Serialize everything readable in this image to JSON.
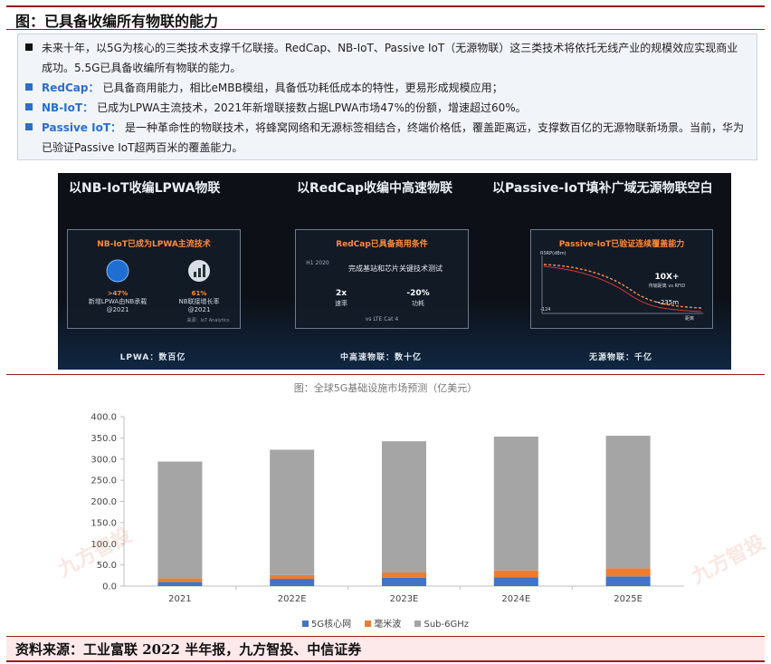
{
  "header": {
    "title": "图：已具备收编所有物联的能力"
  },
  "bullets": [
    {
      "keyword": "",
      "line1": "未来十年，以5G为核心的三类技术支撑千亿联接。RedCap、NB-IoT、Passive IoT（无源物联）这三类技术将依托无线产业的规模效应实现商业",
      "line2": "成功。5.5G已具备收编所有物联的能力。"
    },
    {
      "keyword": "RedCap：",
      "line1": "已具备商用能力，相比eMBB模组，具备低功耗低成本的特性，更易形成规模应用；",
      "line2": ""
    },
    {
      "keyword": "NB-IoT：",
      "line1": "已成为LPWA主流技术，2021年新增联接数占据LPWA市场47%的份额，增速超过60%。",
      "line2": ""
    },
    {
      "keyword": "Passive IoT：",
      "line1": "是一种革命性的物联技术，将蜂窝网络和无源标签相结合，终端价格低，覆盖距离远，支撑数百亿的无源物联新场景。当前，华为",
      "line2": "已验证Passive IoT超两百米的覆盖能力。"
    }
  ],
  "image_panel": {
    "headings": [
      "以NB-IoT收编LPWA物联",
      "以RedCap收编中高速物联",
      "以Passive-IoT填补广域无源物联空白"
    ],
    "cards": [
      {
        "title": "NB-IoT已成为LPWA主流技术",
        "stats": [
          {
            "value": ">47%",
            "label1": "新增LPWA由NB承载",
            "label2": "@2021"
          },
          {
            "value": "61%",
            "label1": "NB联接增长率",
            "label2": "@2021"
          }
        ],
        "source": "来源：IoT Analytics",
        "footer": "LPWA：数百亿"
      },
      {
        "title": "RedCap已具备商用条件",
        "subtitle": "完成基站和芯片关键技术测试",
        "year_label": "H1 2020",
        "stats": [
          {
            "value": "2x",
            "label1": "速率"
          },
          {
            "value": "-20%",
            "label1": "功耗"
          }
        ],
        "note": "vs LTE Cat 4",
        "footer": "中高速物联：数十亿"
      },
      {
        "title": "Passive-IoT已验证连续覆盖能力",
        "y_label": "RSRP(dBm)",
        "x_label": "距离",
        "value_label": "-124",
        "gain": "10X+",
        "gain_note": "传输距离 vs RFID",
        "distance": "~235m",
        "footer": "无源物联：千亿"
      }
    ]
  },
  "chart_data": {
    "type": "bar",
    "stacked": true,
    "title": "图：全球5G基础设施市场预测（亿美元）",
    "categories": [
      "2021",
      "2022E",
      "2023E",
      "2024E",
      "2025E"
    ],
    "series": [
      {
        "name": "5G核心网",
        "color": "#4472c4",
        "values": [
          10,
          17,
          20,
          21,
          23
        ]
      },
      {
        "name": "毫米波",
        "color": "#ed7d31",
        "values": [
          8,
          9,
          12,
          16,
          19
        ]
      },
      {
        "name": "Sub-6GHz",
        "color": "#a5a5a5",
        "values": [
          276,
          296,
          310,
          316,
          313
        ]
      }
    ],
    "ylim": [
      0,
      400
    ],
    "yticks": [
      "0.0",
      "50.0",
      "100.0",
      "150.0",
      "200.0",
      "250.0",
      "300.0",
      "350.0",
      "400.0"
    ],
    "ytick_values": [
      0,
      50,
      100,
      150,
      200,
      250,
      300,
      350,
      400
    ],
    "grid": false,
    "legend_position": "bottom"
  },
  "watermark": "九方智投",
  "footer": {
    "source": "资料来源：工业富联 2022 半年报，九方智投、中信证券"
  },
  "colors": {
    "accent_red": "#9b1b1b",
    "keyword_blue": "#2a6fc9",
    "panel_bg": "#0d1117",
    "orange": "#ff8a3d"
  }
}
